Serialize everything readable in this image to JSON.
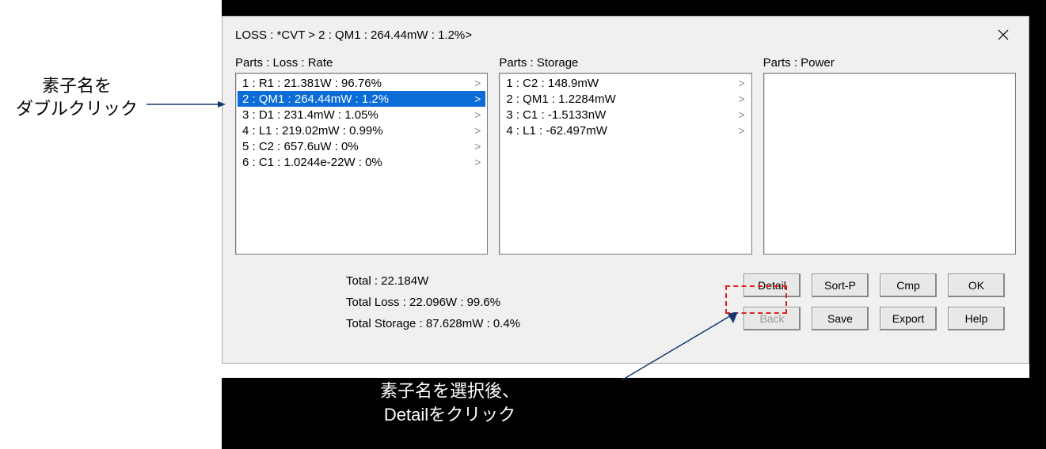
{
  "annotations": {
    "left_line1": "素子名を",
    "left_line2": "ダブルクリック",
    "bottom_line1": "素子名を選択後、",
    "bottom_line2": "Detailをクリック"
  },
  "dialog": {
    "title": "LOSS : *CVT > 2 : QM1 : 264.44mW : 1.2%>",
    "columns": {
      "loss_label": "Parts : Loss : Rate",
      "storage_label": "Parts : Storage",
      "power_label": "Parts : Power"
    },
    "loss_items": [
      {
        "text": "1 : R1 : 21.381W : 96.76%",
        "selected": false
      },
      {
        "text": "2 : QM1 : 264.44mW : 1.2%",
        "selected": true
      },
      {
        "text": "3 : D1 : 231.4mW : 1.05%",
        "selected": false
      },
      {
        "text": "4 : L1 : 219.02mW : 0.99%",
        "selected": false
      },
      {
        "text": "5 : C2 : 657.6uW : 0%",
        "selected": false
      },
      {
        "text": "6 : C1 : 1.0244e-22W : 0%",
        "selected": false
      }
    ],
    "storage_items": [
      {
        "text": "1 : C2 : 148.9mW"
      },
      {
        "text": "2 : QM1 : 1.2284mW"
      },
      {
        "text": "3 : C1 : -1.5133nW"
      },
      {
        "text": "4 : L1 : -62.497mW"
      }
    ],
    "totals": {
      "total": "Total : 22.184W",
      "total_loss": "Total Loss : 22.096W : 99.6%",
      "total_storage": "Total Storage : 87.628mW : 0.4%"
    },
    "buttons": {
      "detail": "Detail",
      "sortp": "Sort-P",
      "cmp": "Cmp",
      "ok": "OK",
      "back": "Back",
      "save": "Save",
      "export": "Export",
      "help": "Help"
    },
    "chevron": ">"
  }
}
